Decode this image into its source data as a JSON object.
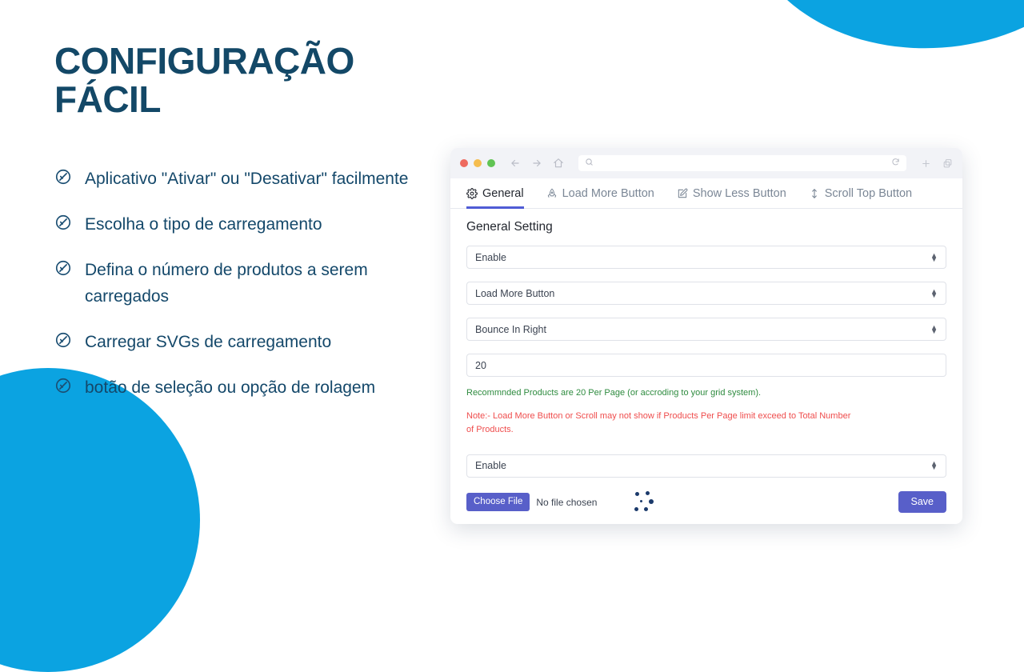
{
  "slide": {
    "title": "CONFIGURAÇÃO FÁCIL",
    "title_color": "#134867",
    "accent_color": "#0ba3e1",
    "features": [
      {
        "icon": "check-circle-icon",
        "text": "Aplicativo \"Ativar\" ou \"Desativar\" facilmente"
      },
      {
        "icon": "check-circle-icon",
        "text": "Escolha o tipo de carregamento"
      },
      {
        "icon": "check-circle-icon",
        "text": "Defina o número de produtos a serem carregados"
      },
      {
        "icon": "check-circle-icon",
        "text": "Carregar SVGs de carregamento"
      },
      {
        "icon": "check-circle-icon",
        "text": "botão de seleção ou opção de rolagem"
      }
    ]
  },
  "browser": {
    "traffic_lights": [
      {
        "name": "close",
        "color": "#ee6a5f"
      },
      {
        "name": "minimize",
        "color": "#f5bd4f"
      },
      {
        "name": "maximize",
        "color": "#61c454"
      }
    ],
    "nav_icons": [
      "back-arrow-icon",
      "forward-arrow-icon",
      "home-icon"
    ],
    "url_bar": {
      "search_icon": "search-icon",
      "value": "",
      "placeholder": "",
      "reload_icon": "reload-icon"
    },
    "right_icons": [
      "plus-icon",
      "duplicate-tabs-icon"
    ]
  },
  "tabs": [
    {
      "label": "General",
      "icon": "gear-icon",
      "active": true
    },
    {
      "label": "Load More Button",
      "icon": "rocket-icon",
      "active": false
    },
    {
      "label": "Show Less Button",
      "icon": "edit-square-icon",
      "active": false
    },
    {
      "label": "Scroll Top Button",
      "icon": "arrow-up-down-icon",
      "active": false
    }
  ],
  "panel": {
    "section_title": "General Setting",
    "fields": [
      {
        "name": "enable-status-select",
        "type": "select",
        "value": "Enable"
      },
      {
        "name": "load-type-select",
        "type": "select",
        "value": "Load More Button"
      },
      {
        "name": "animation-select",
        "type": "select",
        "value": "Bounce In Right"
      },
      {
        "name": "products-per-page-input",
        "type": "text",
        "value": "20"
      }
    ],
    "help_text_green": "Recommnded Products are 20 Per Page (or accroding to your grid system).",
    "help_text_red": "Note:- Load More Button or Scroll may not show if Products Per Page limit exceed to Total Number of Products.",
    "secondary_field": {
      "name": "secondary-enable-select",
      "type": "select",
      "value": "Enable"
    },
    "file_input": {
      "button_label": "Choose File",
      "status_text": "No file chosen"
    },
    "loader_preview": "dot-loader-icon",
    "save_label": "Save",
    "button_color": "#585fc9",
    "active_tab_underline_color": "#4f5bd5"
  }
}
